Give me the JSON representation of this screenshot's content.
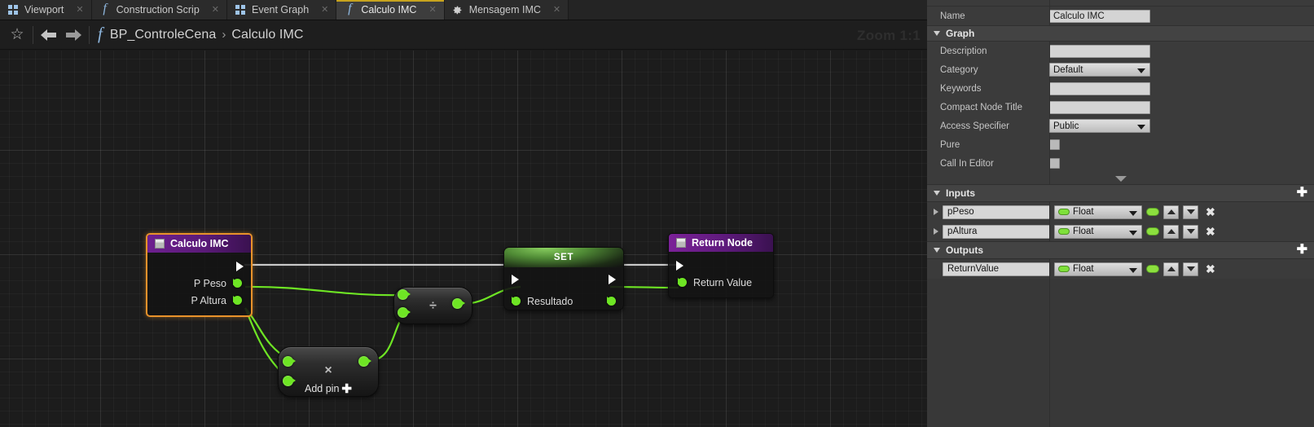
{
  "tabs": [
    {
      "label": "Viewport",
      "icon": "grid4-icon",
      "active": false
    },
    {
      "label": "Construction Scrip",
      "icon": "function-icon",
      "active": false
    },
    {
      "label": "Event Graph",
      "icon": "grid4-icon",
      "active": false
    },
    {
      "label": "Calculo IMC",
      "icon": "function-icon",
      "active": true
    },
    {
      "label": "Mensagem IMC",
      "icon": "gear-icon",
      "active": false
    }
  ],
  "toolbar": {
    "star_icon": "star-icon",
    "back_icon": "back-arrow-icon",
    "forward_icon": "forward-arrow-icon",
    "function_icon": "function-icon",
    "breadcrumb_root": "BP_ControleCena",
    "breadcrumb_sep": "›",
    "breadcrumb_leaf": "Calculo IMC",
    "zoom_label": "Zoom 1:1"
  },
  "graph": {
    "nodes": {
      "entry": {
        "title": "Calculo IMC",
        "selected": true,
        "exec_out": "",
        "pins": [
          "P Peso",
          "P Altura"
        ]
      },
      "multiply": {
        "glyph": "×",
        "add_pin_label": "Add pin",
        "add_pin_plus": "✚"
      },
      "divide": {
        "glyph": "÷"
      },
      "set": {
        "title": "SET",
        "pin": "Resultado"
      },
      "return": {
        "title": "Return Node",
        "pin": "Return Value"
      }
    }
  },
  "details": {
    "name_row": {
      "label": "Name",
      "value": "Calculo IMC"
    },
    "graph_section": {
      "title": "Graph",
      "rows": [
        {
          "label": "Description",
          "value": "",
          "type": "text"
        },
        {
          "label": "Category",
          "value": "Default",
          "type": "dropdown"
        },
        {
          "label": "Keywords",
          "value": "",
          "type": "text"
        },
        {
          "label": "Compact Node Title",
          "value": "",
          "type": "text"
        },
        {
          "label": "Access Specifier",
          "value": "Public",
          "type": "dropdown"
        },
        {
          "label": "Pure",
          "value": "",
          "type": "checkbox"
        },
        {
          "label": "Call In Editor",
          "value": "",
          "type": "checkbox"
        }
      ]
    },
    "inputs_section": {
      "title": "Inputs",
      "add_label": "✚",
      "params": [
        {
          "name": "pPeso",
          "type": "Float"
        },
        {
          "name": "pAltura",
          "type": "Float"
        }
      ]
    },
    "outputs_section": {
      "title": "Outputs",
      "add_label": "✚",
      "params": [
        {
          "name": "ReturnValue",
          "type": "Float"
        }
      ]
    },
    "colors": {
      "float_pin": "#7ee03a",
      "accent_selected": "#e8922b",
      "tab_active_underline": "#c8a41e"
    }
  }
}
